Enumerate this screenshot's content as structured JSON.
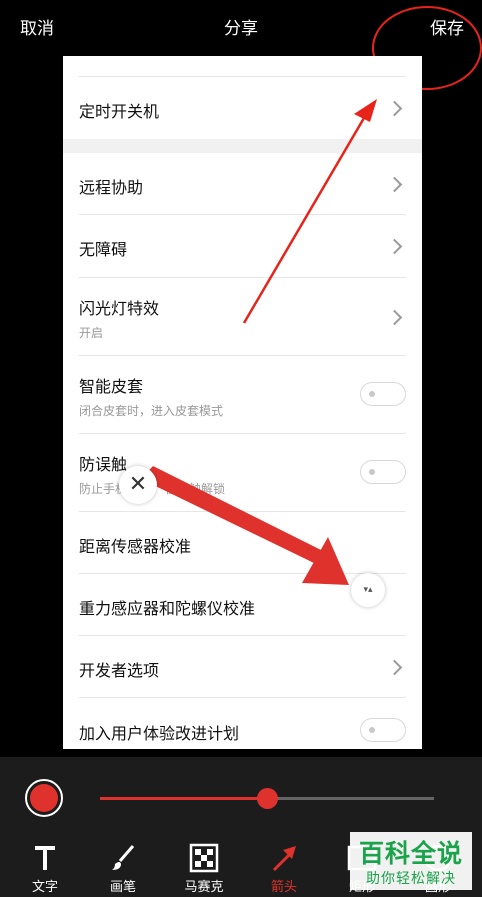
{
  "topbar": {
    "cancel_label": "取消",
    "title": "分享",
    "save_label": "保存"
  },
  "settings": {
    "rows": [
      {
        "label": "定时开关机",
        "control": "chevron"
      },
      {
        "label": "远程协助",
        "control": "chevron"
      },
      {
        "label": "无障碍",
        "control": "chevron"
      },
      {
        "label": "闪光灯特效",
        "subtitle": "开启",
        "control": "chevron"
      },
      {
        "label": "智能皮套",
        "subtitle": "闭合皮套时，进入皮套模式",
        "control": "toggle",
        "on": false
      },
      {
        "label": "防误触",
        "subtitle": "防止手机",
        "subtitle_tail": "被误触解锁",
        "control": "toggle",
        "on": false
      },
      {
        "label": "距离传感器校准",
        "control": "none"
      },
      {
        "label": "重力感应器和陀螺仪校准",
        "control": "none"
      },
      {
        "label": "开发者选项",
        "control": "chevron"
      },
      {
        "label": "加入用户体验改进计划",
        "control": "toggle",
        "on": false
      }
    ]
  },
  "annotation": {
    "color": "#e0322d",
    "delete_glyph": "✕",
    "rotate_glyph": "▾▴"
  },
  "editor": {
    "selected_color": "#e0322d",
    "stroke_size_fraction": 0.5,
    "tools": [
      {
        "label": "文字",
        "icon": "text-icon"
      },
      {
        "label": "画笔",
        "icon": "brush-icon"
      },
      {
        "label": "马赛克",
        "icon": "mosaic-icon"
      },
      {
        "label": "箭头",
        "icon": "arrow-icon",
        "active": true
      },
      {
        "label": "矩形",
        "icon": "rectangle-icon"
      },
      {
        "label": "圆形",
        "icon": "circle-icon"
      }
    ]
  },
  "watermark": {
    "main": "百科全说",
    "sub": "助你轻松解决"
  }
}
